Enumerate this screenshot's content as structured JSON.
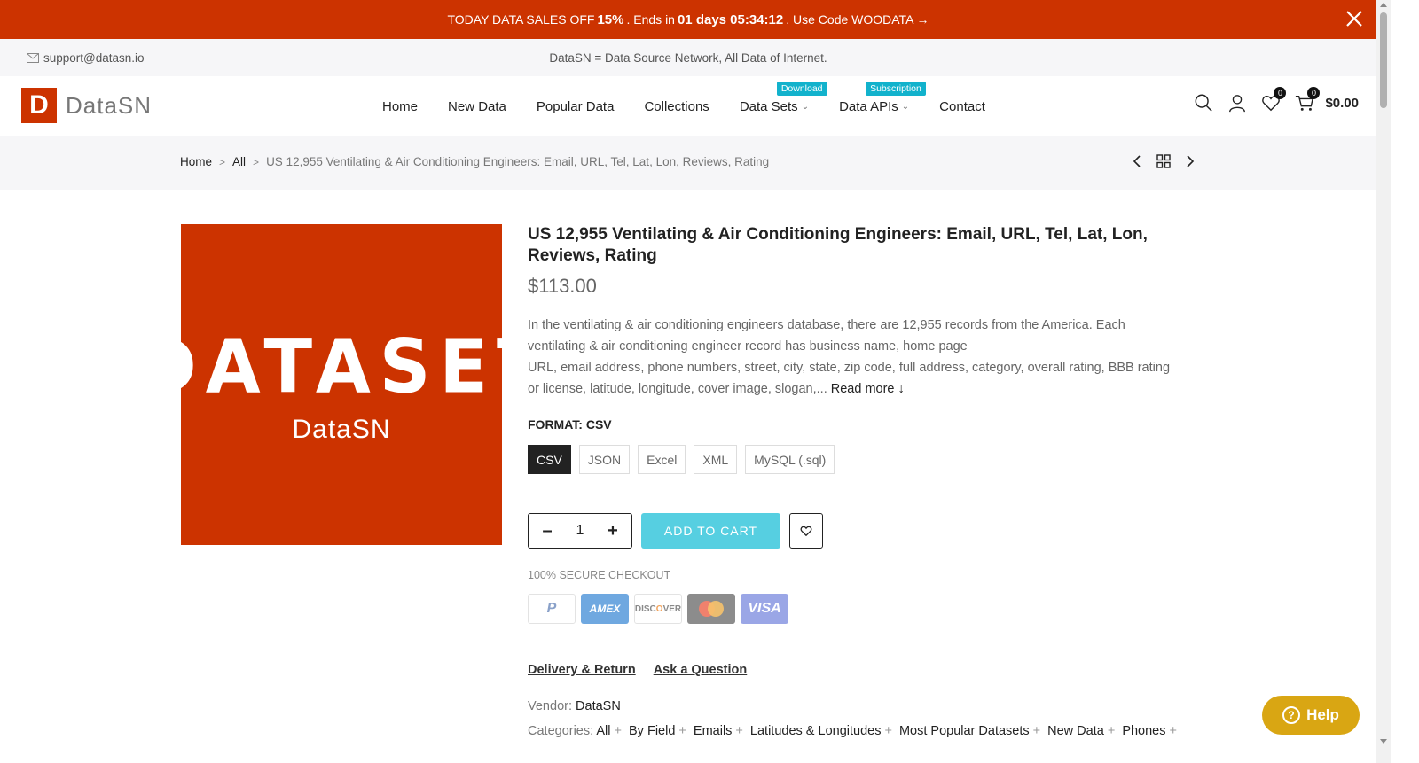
{
  "promo": {
    "prefix": "TODAY DATA SALES OFF",
    "discount": "15%",
    "ends_text": ". Ends in",
    "countdown": "01 days 05:34:12",
    "code_text": ". Use Code WOODATA →"
  },
  "topbar": {
    "email": "support@datasn.io",
    "tagline": "DataSN = Data Source Network, All Data of Internet."
  },
  "header": {
    "logo_letter": "D",
    "logo_text": "DataSN",
    "nav": {
      "home": "Home",
      "new_data": "New Data",
      "popular": "Popular Data",
      "collections": "Collections",
      "data_sets": "Data Sets",
      "data_sets_badge": "Download",
      "data_apis": "Data APIs",
      "data_apis_badge": "Subscription",
      "contact": "Contact"
    },
    "wishlist_count": "0",
    "cart_count": "0",
    "cart_total": "$0.00"
  },
  "breadcrumb": {
    "home": "Home",
    "all": "All",
    "current": "US 12,955 Ventilating & Air Conditioning Engineers: Email, URL, Tel, Lat, Lon, Reviews, Rating"
  },
  "product": {
    "image_big": "DATASET",
    "image_small": "DataSN",
    "title": "US 12,955 Ventilating & Air Conditioning Engineers: Email, URL, Tel, Lat, Lon, Reviews, Rating",
    "price": "$113.00",
    "desc_line1": "In the ventilating & air conditioning engineers database, there are 12,955 records from the America. Each",
    "desc_line2": "ventilating & air conditioning engineer record has business name, home page",
    "desc_line3": "URL, email address, phone numbers, street, city, state, zip code, full address, category, overall rating, BBB rating",
    "desc_line4": "or license, latitude, longitude, cover image, slogan,...",
    "read_more": "Read more ↓",
    "format_label": "FORMAT: CSV",
    "formats": [
      "CSV",
      "JSON",
      "Excel",
      "XML",
      "MySQL (.sql)"
    ],
    "quantity": "1",
    "add_to_cart": "ADD TO CART",
    "secure": "100% SECURE CHECKOUT",
    "cards": [
      "PayPal",
      "AMEX",
      "DISCOVER",
      "Mastercard",
      "VISA"
    ],
    "delivery": "Delivery & Return",
    "ask": "Ask a Question",
    "vendor_label": "Vendor:",
    "vendor": "DataSN",
    "categories_label": "Categories:",
    "categories": [
      "All",
      "By Field",
      "Emails",
      "Latitudes & Longitudes",
      "Most Popular Datasets",
      "New Data",
      "Phones"
    ]
  },
  "help": {
    "label": "Help"
  },
  "colors": {
    "brand": "#cc3300",
    "accent": "#56cfe1",
    "badge": "#12b2cc",
    "help": "#d9a613"
  }
}
